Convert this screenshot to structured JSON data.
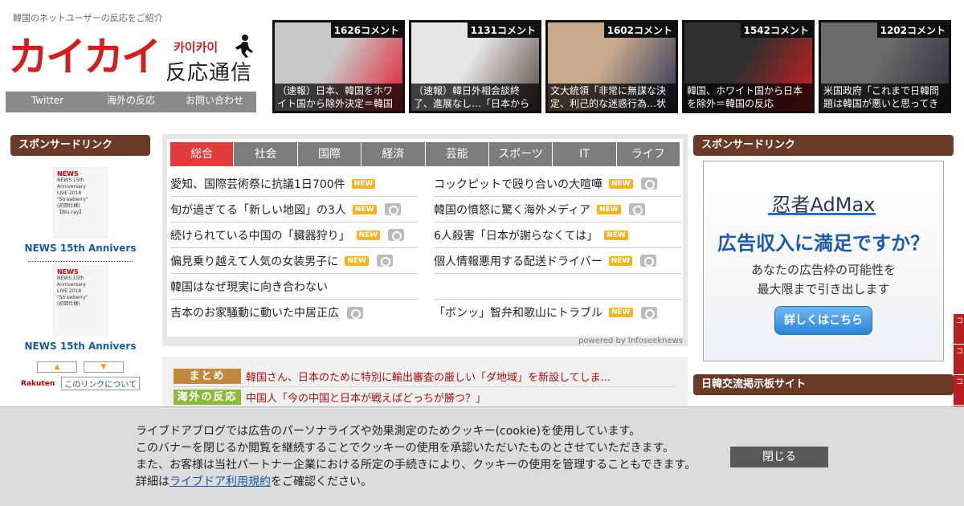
{
  "header": {
    "tagline": "韓国のネットユーザーの反応をご紹介",
    "logo_main": "カイカイ",
    "logo_kana": "카이카이",
    "logo_sub": "反応通信"
  },
  "nav": [
    "Twitter",
    "海外の反応",
    "お問い合わせ"
  ],
  "featured": [
    {
      "count": "1626コメント",
      "caption": "（速報）日本、韓国をホワイト国から除外決定＝韓国の反",
      "colors": [
        "#c8c8c8",
        "#e21c2a"
      ]
    },
    {
      "count": "1131コメント",
      "caption": "（速報）韓日外相会談終了、進展なし…「日本からホワイ",
      "colors": [
        "#e6e6e6",
        "#5a4a42"
      ]
    },
    {
      "count": "1602コメント",
      "caption": "文大統領「非常に無謀な決定、利己的な迷惑行為…状況",
      "colors": [
        "#c9a98c",
        "#2b3556"
      ]
    },
    {
      "count": "1542コメント",
      "caption": "韓国、ホワイト国から日本を除外＝韓国の反応",
      "colors": [
        "#2f2f2f",
        "#d21e1e"
      ]
    },
    {
      "count": "1202コメント",
      "caption": "米国政府「これまで日韓問題は韓国が悪いと思ってきた",
      "colors": [
        "#6a6a6a",
        "#2c2c3a"
      ]
    }
  ],
  "left": {
    "heading": "スポンサードリンク",
    "products": [
      {
        "name": "NEWS 15th Annivers",
        "img": [
          "NEWS",
          "NEWS 15th",
          "Anniversary",
          "LIVE 2018",
          "\"Strawberry\"",
          "(初回仕様)",
          "【Blu-ray】"
        ]
      },
      {
        "name": "NEWS 15th Annivers",
        "img": [
          "NEWS",
          "NEWS 15th",
          "Anniversary",
          "LIVE 2018",
          "\"Strawberry\"",
          "(初回仕様)"
        ]
      }
    ],
    "up": "▲",
    "down": "▼",
    "rakuten": "Rakuten",
    "link_about": "このリンクについて"
  },
  "news": {
    "tabs": [
      "総合",
      "社会",
      "国際",
      "経済",
      "芸能",
      "スポーツ",
      "IT",
      "ライフ"
    ],
    "items": [
      {
        "title": "愛知、国際芸術祭に抗議1日700件",
        "new": true,
        "photo": false
      },
      {
        "title": "コックピットで殴り合いの大喧嘩",
        "new": true,
        "photo": true
      },
      {
        "title": "旬が過ぎてる「新しい地図」の3人",
        "new": true,
        "photo": true
      },
      {
        "title": "韓国の憤怒に驚く海外メディア",
        "new": true,
        "photo": true
      },
      {
        "title": "続けられている中国の「臓器狩り」",
        "new": true,
        "photo": true
      },
      {
        "title": "6人殺害「日本が謝らなくては」",
        "new": true,
        "photo": false
      },
      {
        "title": "偏見乗り越えて人気の女装男子に",
        "new": true,
        "photo": true
      },
      {
        "title": "個人情報悪用する配送ドライバー",
        "new": true,
        "photo": true
      },
      {
        "title": "韓国はなぜ現実に向き合わない",
        "new": false,
        "photo": false
      },
      {
        "title": "",
        "new": false,
        "photo": false
      },
      {
        "title": "吉本のお家騒動に動いた中居正広",
        "new": false,
        "photo": true
      },
      {
        "title": "「ボンッ」智弁和歌山にトラブル",
        "new": true,
        "photo": true
      }
    ],
    "new_label": "NEW",
    "powered": "powered by Infoseeknews"
  },
  "feed": [
    {
      "category": "まとめ",
      "color": "#c08a3e",
      "title": "韓国さん、日本のために特別に輸出審査の厳しい「ダ地域」を新設してしま..."
    },
    {
      "category": "海外の反応",
      "color": "#8cba3c",
      "title": "中国人「今の中国と日本が戦えばどっちが勝つ？」"
    }
  ],
  "right": {
    "heading": "スポンサードリンク",
    "ad": {
      "brand": "忍者AdMax",
      "headline": "広告収入に満足ですか？",
      "sub1": "あなたの広告枠の可能性を",
      "sub2": "最大限まで引き出します",
      "button": "詳しくはこちら"
    },
    "heading2": "日韓交流掲示板サイト"
  },
  "edge": [
    "コ",
    "コ",
    "コ"
  ],
  "cookie": {
    "line1": "ライブドアブログでは広告のパーソナライズや効果測定のためクッキー(cookie)を使用しています。",
    "line2": "このバナーを閉じるか閲覧を継続することでクッキーの使用を承認いただいたものとさせていただきます。",
    "line3": "また、お客様は当社パートナー企業における所定の手続きにより、クッキーの使用を管理することもできます。",
    "line4_prefix": "詳細は",
    "link": "ライブドア利用規約",
    "line4_suffix": "をご確認ください。",
    "close": "閉じる"
  }
}
